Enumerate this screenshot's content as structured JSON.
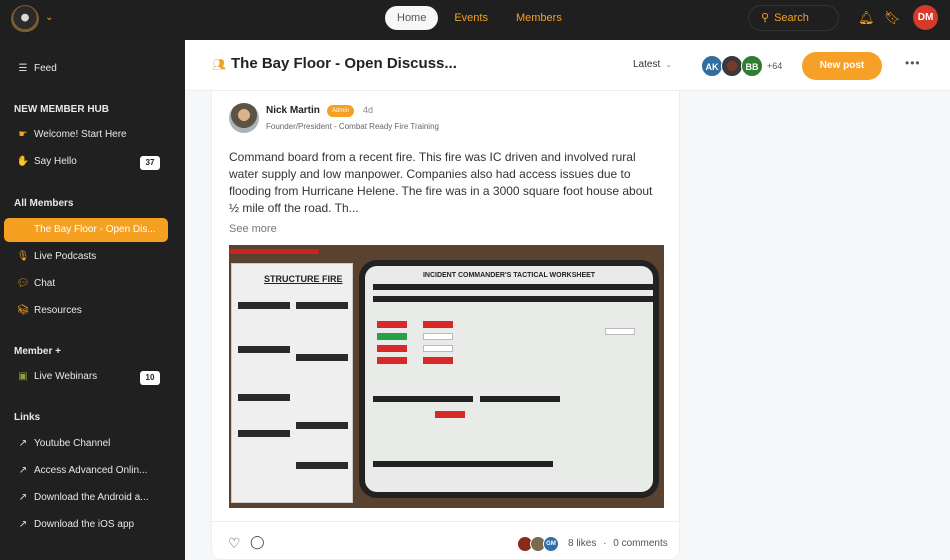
{
  "topbar": {
    "nav": [
      {
        "label": "Home",
        "active": true
      },
      {
        "label": "Events",
        "active": false
      },
      {
        "label": "Members",
        "active": false
      }
    ],
    "search_label": "Search",
    "user_initials": "DM",
    "accent_color": "#f5a020",
    "user_avatar_color": "#d63a2b"
  },
  "sidebar": {
    "feed": {
      "label": "Feed",
      "icon": "feed-icon"
    },
    "sections": [
      {
        "heading": "NEW MEMBER HUB",
        "items": [
          {
            "label": "Welcome! Start Here",
            "icon": "pointing-hand-icon"
          },
          {
            "label": "Say Hello",
            "icon": "waving-hand-icon",
            "badge": "37"
          }
        ]
      },
      {
        "heading": "All Members",
        "items": [
          {
            "label": "The Bay Floor - Open Dis...",
            "icon": "group-icon",
            "active": true
          },
          {
            "label": "Live Podcasts",
            "icon": "microphone-icon"
          },
          {
            "label": "Chat",
            "icon": "chat-bubble-icon"
          },
          {
            "label": "Resources",
            "icon": "books-icon"
          }
        ]
      },
      {
        "heading": "Member +",
        "items": [
          {
            "label": "Live Webinars",
            "icon": "webinar-screen-icon",
            "badge": "10"
          }
        ]
      },
      {
        "heading": "Links",
        "items": [
          {
            "label": "Youtube Channel",
            "icon": "external-link-icon"
          },
          {
            "label": "Access Advanced Onlin...",
            "icon": "external-link-icon"
          },
          {
            "label": "Download the Android a...",
            "icon": "external-link-icon"
          },
          {
            "label": "Download the iOS app",
            "icon": "external-link-icon"
          }
        ]
      }
    ]
  },
  "header": {
    "title": "The Bay Floor - Open Discuss...",
    "sort_label": "Latest",
    "member_avatars": [
      {
        "initials": "AK",
        "color": "#2f6e9e"
      },
      {
        "initials": "",
        "color": "#4a4a4a"
      },
      {
        "initials": "BB",
        "color": "#2e7d32"
      }
    ],
    "more_members": "+64",
    "new_post_label": "New post",
    "more_label": "•••"
  },
  "post": {
    "author": "Nick Martin",
    "badge": "Admin",
    "time": "4d",
    "role": "Founder/President - Combat Ready Fire Training",
    "body": "Command board from a recent fire. This fire was IC driven and involved rural water supply and low manpower. Companies also had access issues due to flooding from Hurricane Helene. The fire was in a 3000 square foot house about ½ mile off the road. Th...",
    "see_more": "See more",
    "image": {
      "notebook_title": "STRUCTURE FIRE",
      "board_title": "INCIDENT COMMANDER'S TACTICAL WORKSHEET"
    },
    "likers": [
      {
        "initials": "",
        "color": "#8b2a1c"
      },
      {
        "initials": "",
        "color": "#7a6a50"
      },
      {
        "initials": "GM",
        "color": "#2f6eaa"
      }
    ],
    "likes": "8 likes",
    "separator": "·",
    "comments": "0 comments"
  }
}
